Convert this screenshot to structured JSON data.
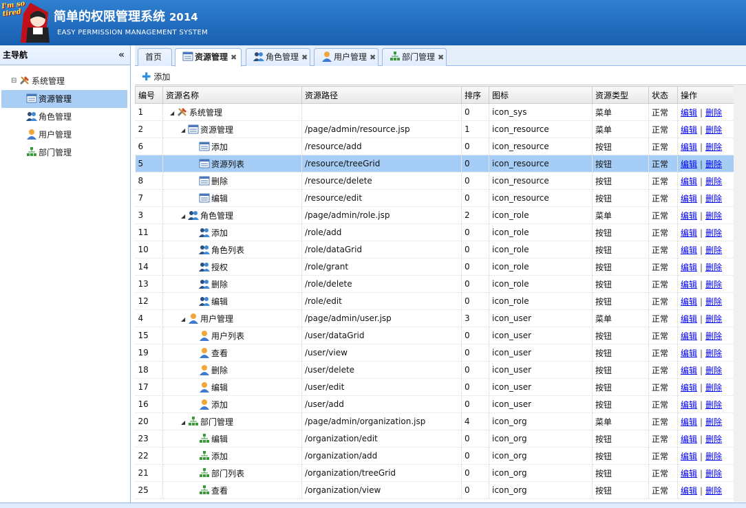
{
  "header": {
    "logo_text_1": "I'm so",
    "logo_text_2": "tired",
    "title": "简单的权限管理系统",
    "year": "2014",
    "subtitle": "EASY PERMISSION MANAGEMENT SYSTEM"
  },
  "sidebar": {
    "title": "主导航",
    "collapse": "«",
    "root": "系统管理",
    "items": [
      "资源管理",
      "角色管理",
      "用户管理",
      "部门管理"
    ]
  },
  "tabs": [
    {
      "label": "首页",
      "icon": "none",
      "closable": false
    },
    {
      "label": "资源管理",
      "icon": "icon_resource",
      "closable": true
    },
    {
      "label": "角色管理",
      "icon": "icon_role",
      "closable": true
    },
    {
      "label": "用户管理",
      "icon": "icon_user",
      "closable": true
    },
    {
      "label": "部门管理",
      "icon": "icon_org",
      "closable": true
    }
  ],
  "toolbar": {
    "add_label": "添加"
  },
  "grid": {
    "columns": [
      "编号",
      "资源名称",
      "资源路径",
      "排序",
      "图标",
      "资源类型",
      "状态",
      "操作"
    ],
    "edit_label": "编辑",
    "delete_label": "删除",
    "rows": [
      {
        "id": "1",
        "level": 0,
        "expand": true,
        "name": "系统管理",
        "path": "",
        "order": "0",
        "icon": "icon_sys",
        "type": "菜单",
        "status": "正常"
      },
      {
        "id": "2",
        "level": 1,
        "expand": true,
        "name": "资源管理",
        "path": "/page/admin/resource.jsp",
        "order": "1",
        "icon": "icon_resource",
        "type": "菜单",
        "status": "正常"
      },
      {
        "id": "6",
        "level": 2,
        "expand": false,
        "name": "添加",
        "path": "/resource/add",
        "order": "0",
        "icon": "icon_resource",
        "type": "按钮",
        "status": "正常"
      },
      {
        "id": "5",
        "level": 2,
        "expand": false,
        "name": "资源列表",
        "path": "/resource/treeGrid",
        "order": "0",
        "icon": "icon_resource",
        "type": "按钮",
        "status": "正常",
        "selected": true
      },
      {
        "id": "8",
        "level": 2,
        "expand": false,
        "name": "删除",
        "path": "/resource/delete",
        "order": "0",
        "icon": "icon_resource",
        "type": "按钮",
        "status": "正常"
      },
      {
        "id": "7",
        "level": 2,
        "expand": false,
        "name": "编辑",
        "path": "/resource/edit",
        "order": "0",
        "icon": "icon_resource",
        "type": "按钮",
        "status": "正常"
      },
      {
        "id": "3",
        "level": 1,
        "expand": true,
        "name": "角色管理",
        "path": "/page/admin/role.jsp",
        "order": "2",
        "icon": "icon_role",
        "type": "菜单",
        "status": "正常"
      },
      {
        "id": "11",
        "level": 2,
        "expand": false,
        "name": "添加",
        "path": "/role/add",
        "order": "0",
        "icon": "icon_role",
        "type": "按钮",
        "status": "正常"
      },
      {
        "id": "10",
        "level": 2,
        "expand": false,
        "name": "角色列表",
        "path": "/role/dataGrid",
        "order": "0",
        "icon": "icon_role",
        "type": "按钮",
        "status": "正常"
      },
      {
        "id": "14",
        "level": 2,
        "expand": false,
        "name": "授权",
        "path": "/role/grant",
        "order": "0",
        "icon": "icon_role",
        "type": "按钮",
        "status": "正常"
      },
      {
        "id": "13",
        "level": 2,
        "expand": false,
        "name": "删除",
        "path": "/role/delete",
        "order": "0",
        "icon": "icon_role",
        "type": "按钮",
        "status": "正常"
      },
      {
        "id": "12",
        "level": 2,
        "expand": false,
        "name": "编辑",
        "path": "/role/edit",
        "order": "0",
        "icon": "icon_role",
        "type": "按钮",
        "status": "正常"
      },
      {
        "id": "4",
        "level": 1,
        "expand": true,
        "name": "用户管理",
        "path": "/page/admin/user.jsp",
        "order": "3",
        "icon": "icon_user",
        "type": "菜单",
        "status": "正常"
      },
      {
        "id": "15",
        "level": 2,
        "expand": false,
        "name": "用户列表",
        "path": "/user/dataGrid",
        "order": "0",
        "icon": "icon_user",
        "type": "按钮",
        "status": "正常"
      },
      {
        "id": "19",
        "level": 2,
        "expand": false,
        "name": "查看",
        "path": "/user/view",
        "order": "0",
        "icon": "icon_user",
        "type": "按钮",
        "status": "正常"
      },
      {
        "id": "18",
        "level": 2,
        "expand": false,
        "name": "删除",
        "path": "/user/delete",
        "order": "0",
        "icon": "icon_user",
        "type": "按钮",
        "status": "正常"
      },
      {
        "id": "17",
        "level": 2,
        "expand": false,
        "name": "编辑",
        "path": "/user/edit",
        "order": "0",
        "icon": "icon_user",
        "type": "按钮",
        "status": "正常"
      },
      {
        "id": "16",
        "level": 2,
        "expand": false,
        "name": "添加",
        "path": "/user/add",
        "order": "0",
        "icon": "icon_user",
        "type": "按钮",
        "status": "正常"
      },
      {
        "id": "20",
        "level": 1,
        "expand": true,
        "name": "部门管理",
        "path": "/page/admin/organization.jsp",
        "order": "4",
        "icon": "icon_org",
        "type": "菜单",
        "status": "正常"
      },
      {
        "id": "23",
        "level": 2,
        "expand": false,
        "name": "编辑",
        "path": "/organization/edit",
        "order": "0",
        "icon": "icon_org",
        "type": "按钮",
        "status": "正常"
      },
      {
        "id": "22",
        "level": 2,
        "expand": false,
        "name": "添加",
        "path": "/organization/add",
        "order": "0",
        "icon": "icon_org",
        "type": "按钮",
        "status": "正常"
      },
      {
        "id": "21",
        "level": 2,
        "expand": false,
        "name": "部门列表",
        "path": "/organization/treeGrid",
        "order": "0",
        "icon": "icon_org",
        "type": "按钮",
        "status": "正常"
      },
      {
        "id": "25",
        "level": 2,
        "expand": false,
        "name": "查看",
        "path": "/organization/view",
        "order": "0",
        "icon": "icon_org",
        "type": "按钮",
        "status": "正常"
      }
    ]
  }
}
